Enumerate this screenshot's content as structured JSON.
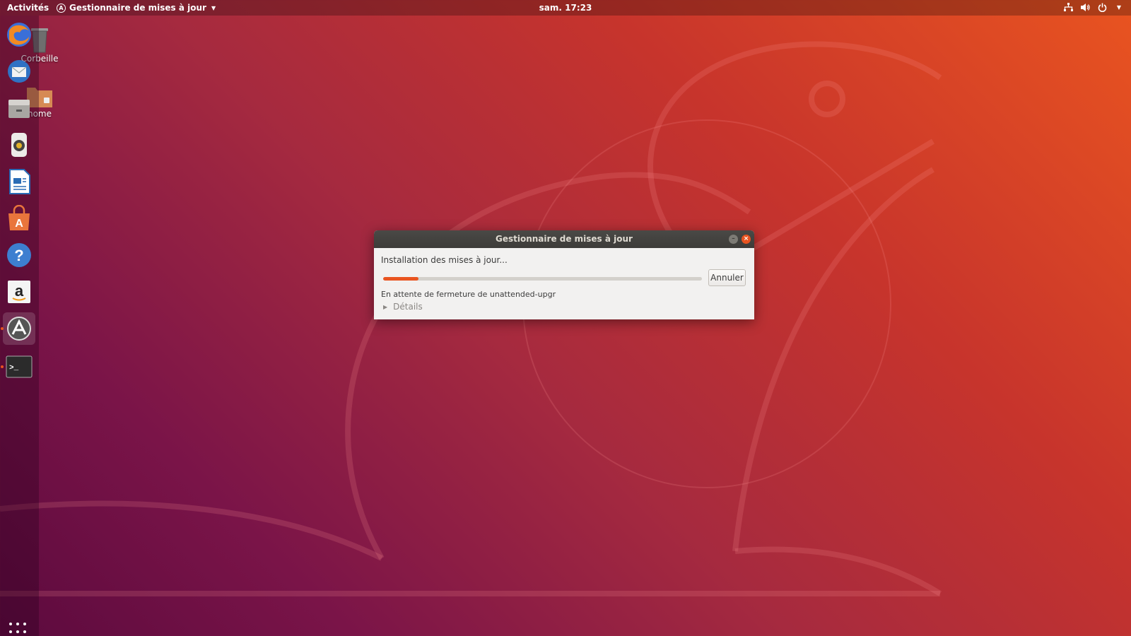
{
  "topbar": {
    "activities": "Activités",
    "app_name": "Gestionnaire de mises à jour",
    "app_icon": "A",
    "clock": "sam. 17:23",
    "status_icons": [
      "network-icon",
      "volume-icon",
      "power-icon",
      "chevron-down-icon"
    ]
  },
  "desktop": {
    "trash_label": "Corbeille",
    "home_label": "home"
  },
  "dock": {
    "items": [
      {
        "name": "firefox",
        "icon": "firefox-icon"
      },
      {
        "name": "thunderbird",
        "icon": "thunderbird-icon"
      },
      {
        "name": "files",
        "icon": "files-icon"
      },
      {
        "name": "rhythmbox",
        "icon": "rhythmbox-icon"
      },
      {
        "name": "libreoffice-writer",
        "icon": "writer-icon"
      },
      {
        "name": "ubuntu-software",
        "icon": "software-icon"
      },
      {
        "name": "help",
        "icon": "help-icon"
      },
      {
        "name": "amazon",
        "icon": "amazon-icon"
      },
      {
        "name": "software-updater",
        "icon": "updater-icon",
        "active": true
      },
      {
        "name": "terminal",
        "icon": "terminal-icon",
        "running": true
      }
    ],
    "help_glyph": "?",
    "amazon_glyph": "a",
    "software_glyph": "A",
    "terminal_prompt": ">_"
  },
  "dialog": {
    "title": "Gestionnaire de mises à jour",
    "minimize_glyph": "–",
    "close_glyph": "×",
    "heading": "Installation des mises à jour...",
    "progress_fraction": 0.11,
    "cancel_label": "Annuler",
    "status": "En attente de fermeture de unattended-upgr",
    "details_arrow": "▶",
    "details_label": "Détails"
  },
  "colors": {
    "accent": "#e95420",
    "titlebar": "#3d3c39",
    "dialog_bg": "#f2f1f0"
  }
}
